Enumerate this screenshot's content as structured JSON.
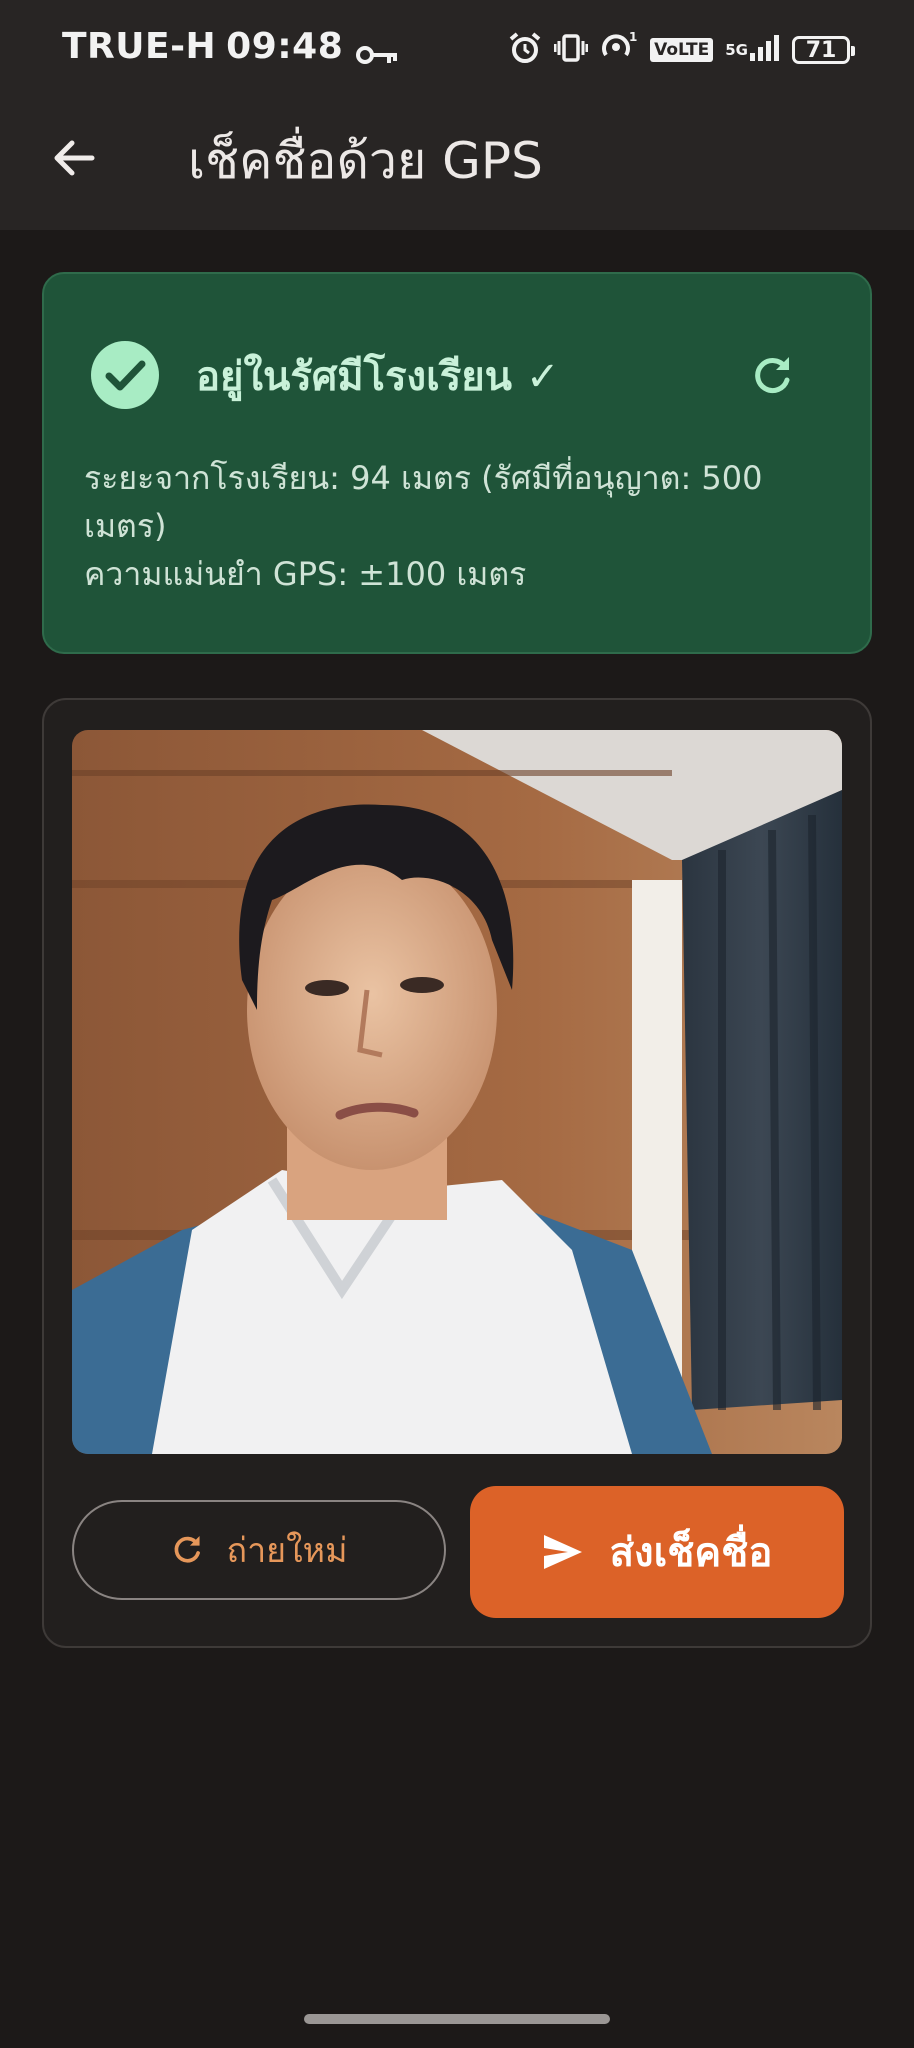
{
  "status_bar": {
    "carrier": "TRUE-H",
    "time": "09:48",
    "network": "5G",
    "volte": "VoLTE",
    "signal_sup": "1",
    "battery": "71"
  },
  "app_bar": {
    "title": "เช็คชื่อด้วย GPS"
  },
  "location_status": {
    "title": "อยู่ในรัศมีโรงเรียน ✓",
    "distance_line": "ระยะจากโรงเรียน: 94 เมตร  (รัศมีที่อนุญาต: 500 เมตร)",
    "accuracy_line": "ความแม่นยำ GPS: ±100 เมตร",
    "colors": {
      "card_bg": "#1f5439",
      "accent": "#a8ecc4"
    }
  },
  "actions": {
    "retake_label": "ถ่ายใหม่",
    "submit_label": "ส่งเช็คชื่อ",
    "colors": {
      "submit_bg": "#dc6228",
      "retake_text": "#e6975a"
    }
  },
  "icons": [
    "back-arrow-icon",
    "check-circle-icon",
    "refresh-icon",
    "send-icon",
    "key-icon",
    "alarm-icon",
    "vibrate-icon",
    "hotspot-icon",
    "signal-icon",
    "battery-icon"
  ]
}
